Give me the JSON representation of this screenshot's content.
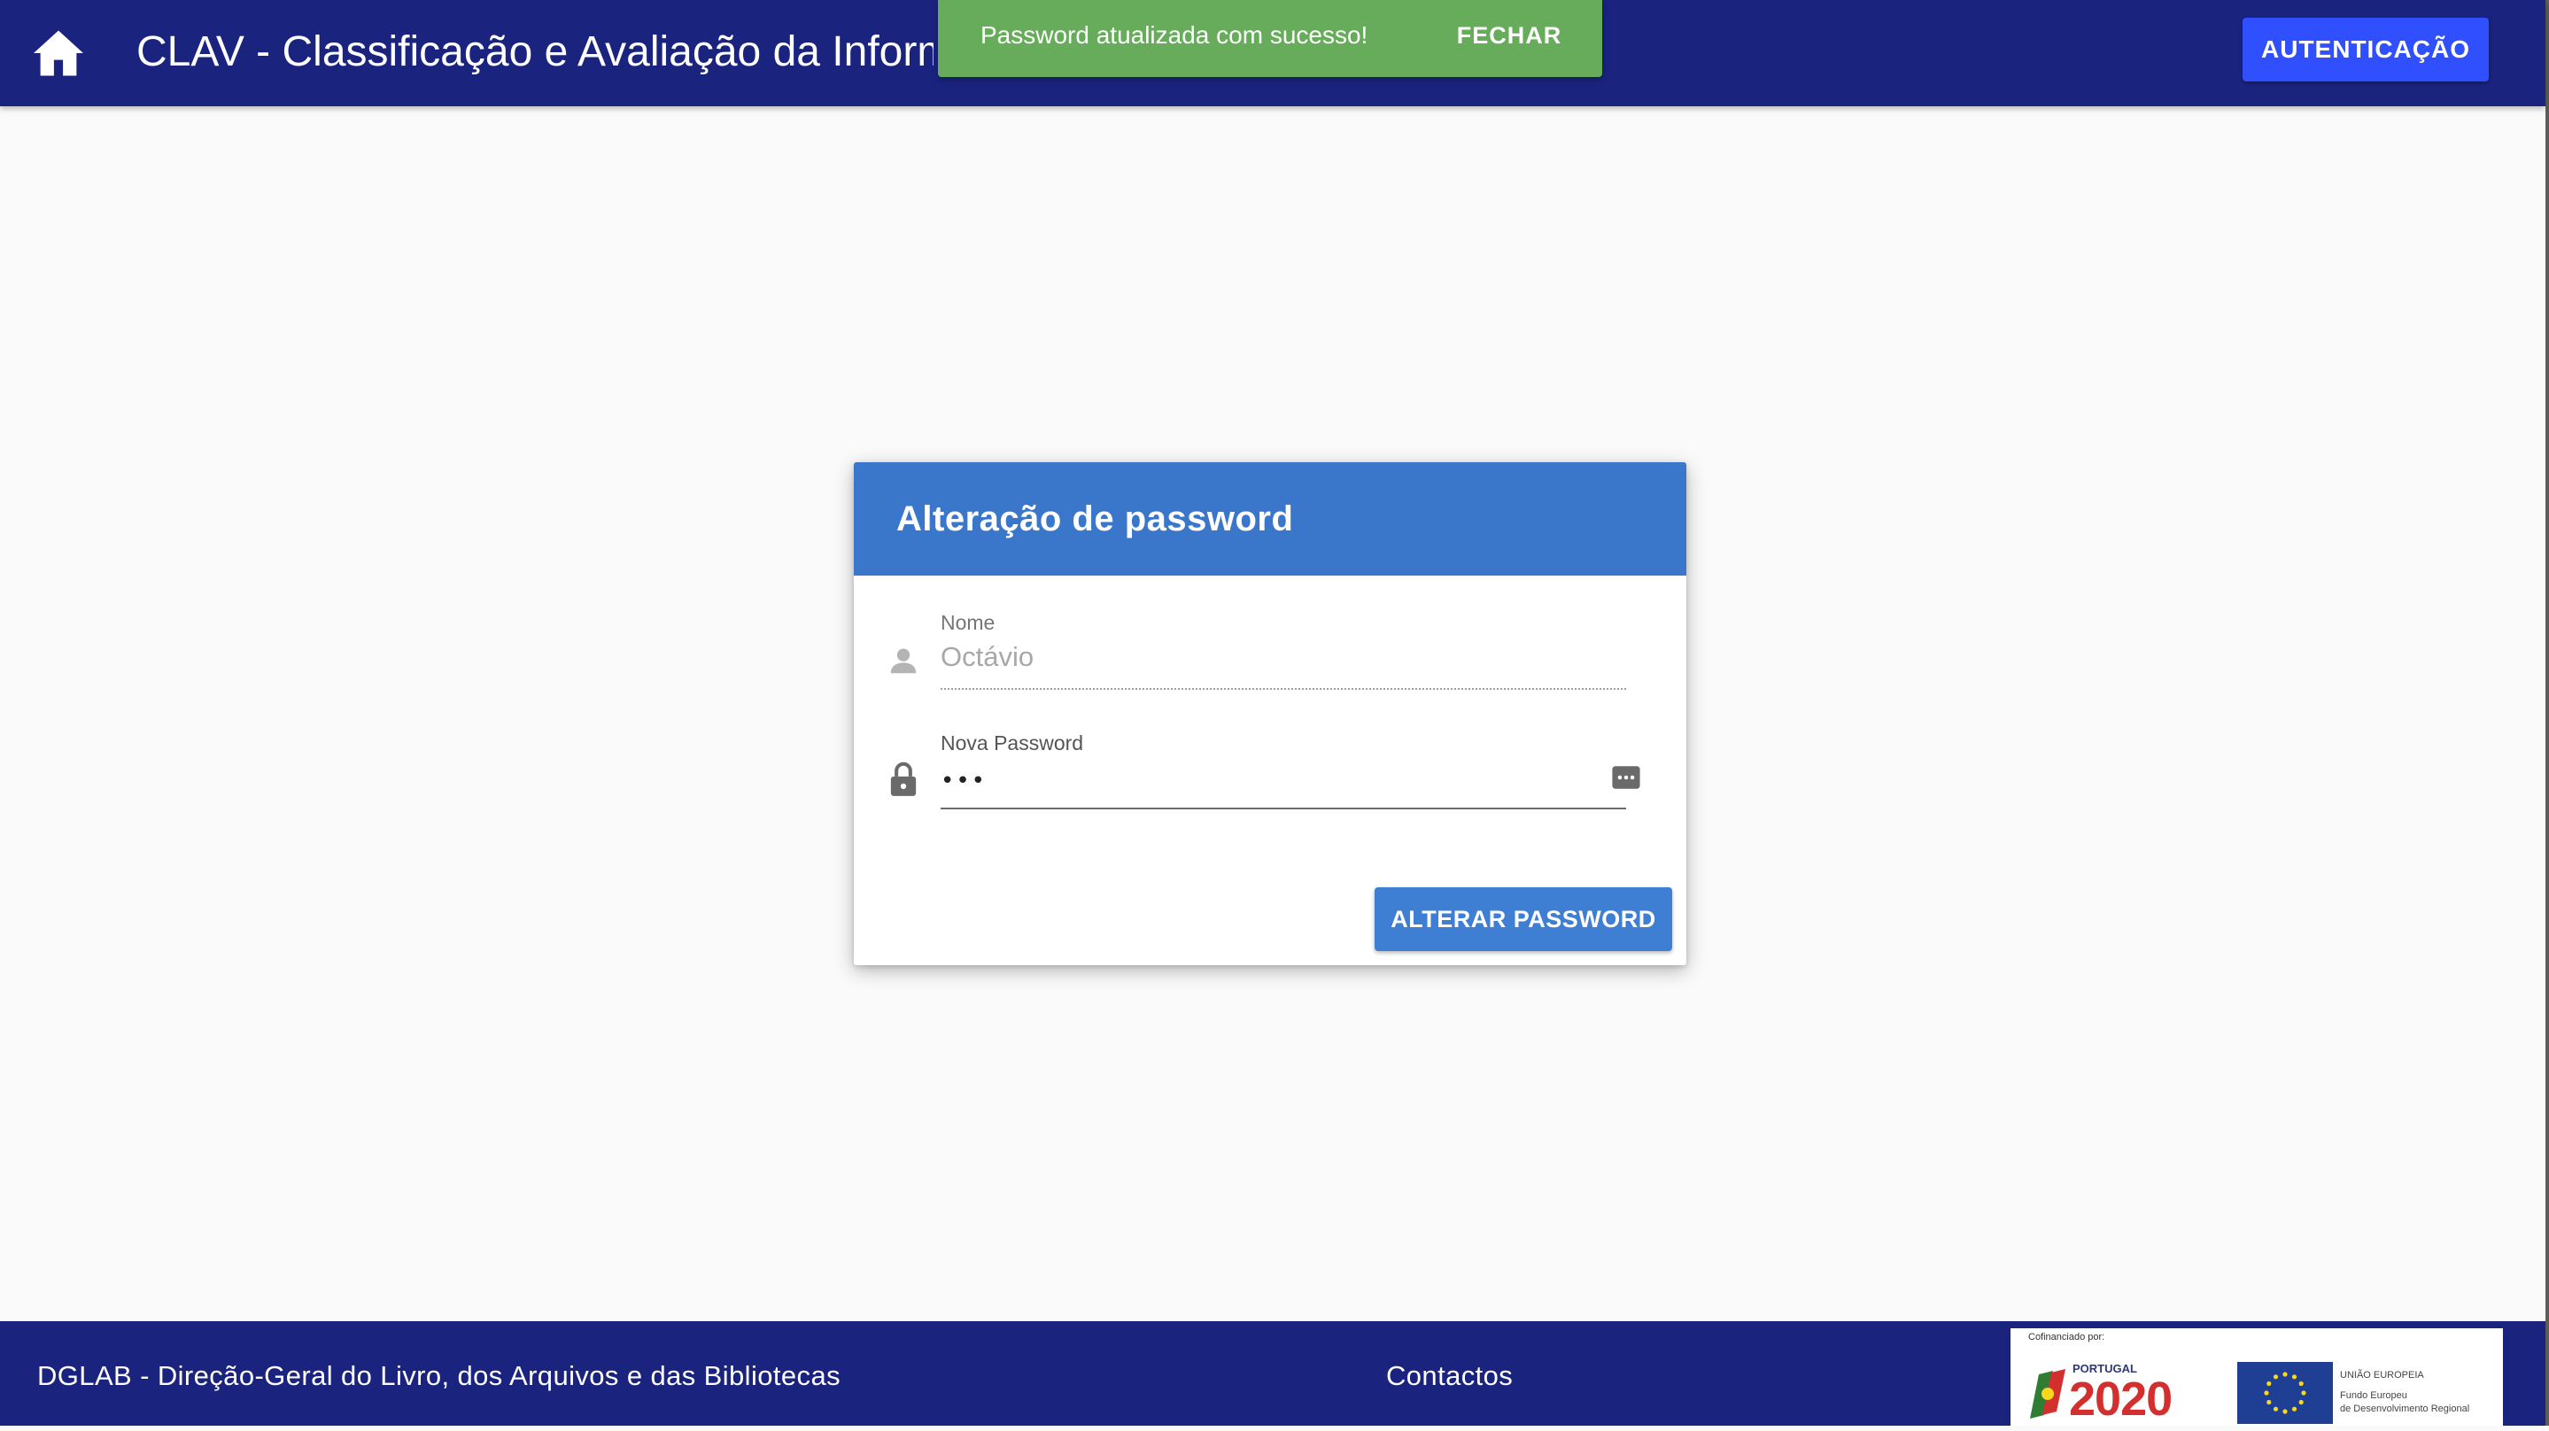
{
  "appbar": {
    "brand": "CLAV",
    "subtitle": " - Classificação e Avaliação da Informação",
    "auth_button": "AUTENTICAÇÃO",
    "home_icon": "home-icon"
  },
  "snackbar": {
    "message": "Password atualizada com sucesso!",
    "close_label": "FECHAR",
    "color": "#66ac5a"
  },
  "card": {
    "title": "Alteração de password",
    "name_field": {
      "label": "Nome",
      "value": "Octávio",
      "icon": "person-icon"
    },
    "password_field": {
      "label": "Nova Password",
      "value": "•••",
      "icon": "lock-icon",
      "toggle_icon": "password-dots-icon"
    },
    "submit_button": "ALTERAR PASSWORD"
  },
  "footer": {
    "organization": "DGLAB - Direção-Geral do Livro, dos Arquivos e das Bibliotecas",
    "contacts": "Contactos",
    "funding": {
      "caption": "Cofinanciado por:",
      "program_small": "PORTUGAL",
      "program_big": "2020",
      "eu_line1": "UNIÃO EUROPEIA",
      "eu_line2": "Fundo Europeu",
      "eu_line3": "de Desenvolvimento Regional"
    }
  },
  "colors": {
    "primary_dark": "#1a237e",
    "card_header": "#3a77cb",
    "accent_button": "#304ffe",
    "submit_button": "#3f7fd3"
  }
}
